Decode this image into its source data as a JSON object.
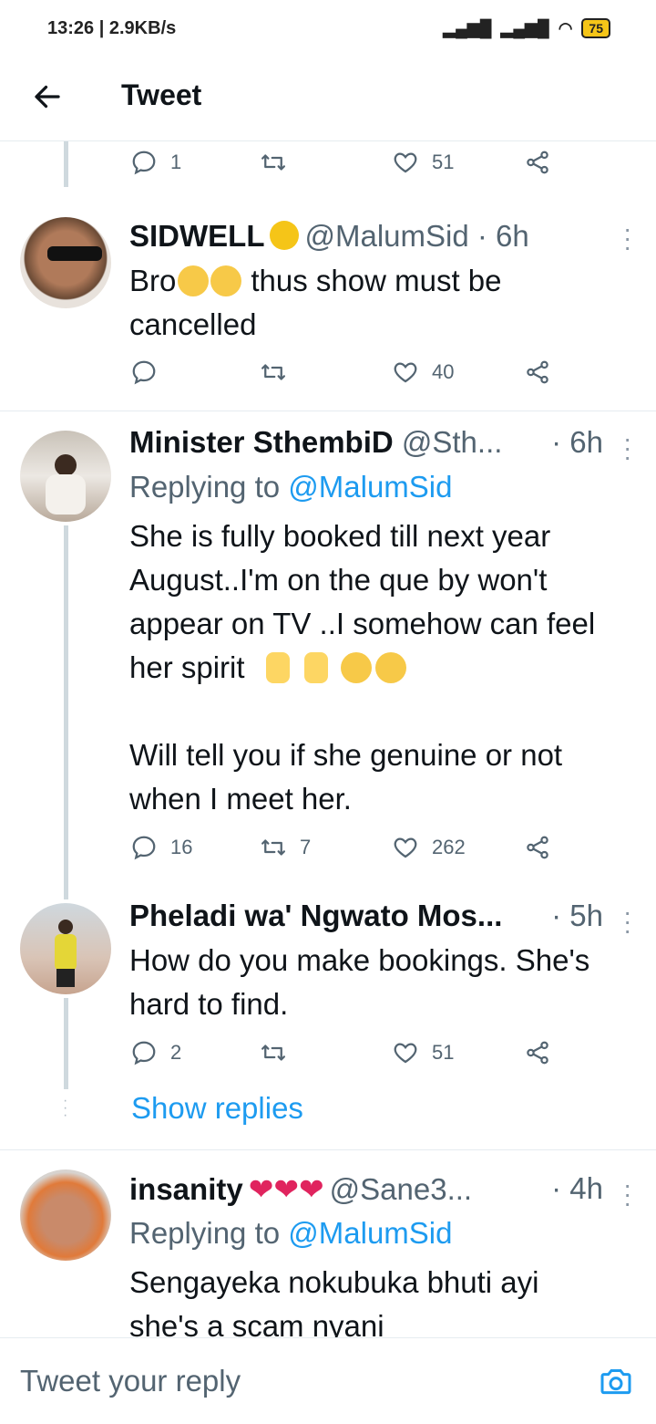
{
  "status_bar": {
    "time": "13:26",
    "speed": "2.9KB/s",
    "battery": "75"
  },
  "header": {
    "title": "Tweet"
  },
  "top_actions": {
    "replies": "1",
    "likes": "51"
  },
  "tweets": [
    {
      "display_name": "SIDWELL",
      "handle": "@MalumSid · 6h",
      "text_lines": [
        "Bro",
        "thus show must be",
        "cancelled"
      ],
      "replies": "",
      "retweets": "",
      "likes": "40"
    },
    {
      "display_name": "Minister SthembiD",
      "handle": "@Sth...",
      "time": "· 6h",
      "replying_prefix": "Replying to ",
      "replying_to": "@MalumSid",
      "text_lines": [
        "She is fully booked till next year",
        "August..I'm on the que by won't",
        "appear on TV ..I somehow can feel",
        "her spirit",
        "Will tell you if she genuine or not",
        "when I meet her."
      ],
      "replies": "16",
      "retweets": "7",
      "likes": "262"
    },
    {
      "display_name": "Pheladi wa' Ngwato Mos...",
      "time": "· 5h",
      "text_lines": [
        "How do you make bookings. She's",
        "hard to find."
      ],
      "replies": "2",
      "retweets": "",
      "likes": "51"
    },
    {
      "display_name": "insanity",
      "handle": "@Sane3...",
      "time": "· 4h",
      "replying_prefix": "Replying to ",
      "replying_to": "@MalumSid",
      "text_lines": [
        "Sengayeka nokubuka bhuti ayi",
        "she's a scam nyani"
      ]
    }
  ],
  "show_replies": "Show replies",
  "reply_bar": {
    "placeholder": "Tweet your reply"
  },
  "icons": [
    "back-arrow-icon",
    "reply-icon",
    "retweet-icon",
    "like-icon",
    "share-icon",
    "more-icon",
    "camera-icon"
  ],
  "colors": {
    "link": "#1d9bf0",
    "muted": "#536471",
    "battery": "#f5c518"
  }
}
